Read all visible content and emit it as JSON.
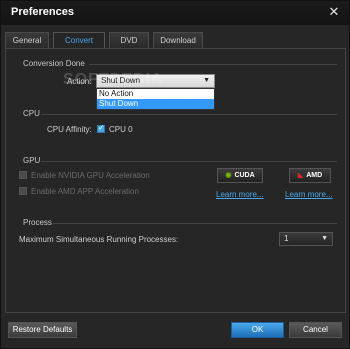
{
  "window": {
    "title": "Preferences",
    "close_glyph": "✕"
  },
  "tabs": [
    {
      "label": "General",
      "active": false
    },
    {
      "label": "Convert",
      "active": true
    },
    {
      "label": "DVD",
      "active": false
    },
    {
      "label": "Download",
      "active": false
    }
  ],
  "conversion_done": {
    "section_label": "Conversion Done",
    "action_label": "Action:",
    "action_value": "Shut Down",
    "options": [
      "No Action",
      "Shut Down"
    ],
    "selected_option": "Shut Down"
  },
  "watermark": "SOFTPEDIA",
  "cpu": {
    "section_label": "CPU",
    "affinity_label": "CPU Affinity:",
    "cpu0_label": "CPU 0",
    "cpu0_checked": true
  },
  "gpu": {
    "section_label": "GPU",
    "nvidia_label": "Enable NVIDIA GPU Acceleration",
    "amd_label": "Enable AMD APP Acceleration",
    "cuda_badge": "CUDA",
    "amd_badge": "AMD",
    "learn_more_nvidia": "Learn more...",
    "learn_more_amd": "Learn more..."
  },
  "process": {
    "section_label": "Process",
    "max_label": "Maximum Simultaneous Running Processes:",
    "max_value": "1"
  },
  "footer": {
    "restore_label": "Restore Defaults",
    "ok_label": "OK",
    "cancel_label": "Cancel"
  },
  "colors": {
    "accent": "#4aa6e8",
    "background": "#262626",
    "selection": "#3399ff"
  }
}
